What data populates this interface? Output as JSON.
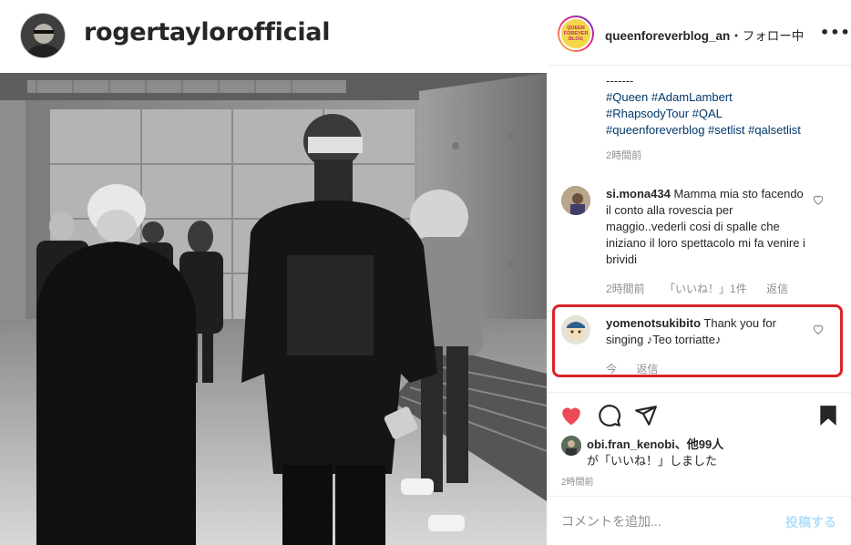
{
  "post": {
    "author": "rogertaylorofficial"
  },
  "panel": {
    "account": "queenforeverblog_an",
    "follow_status": "・フォロー中",
    "more": "•••",
    "avatar_text": "QUEEN FOREVER BLOG"
  },
  "caption": {
    "divider": "-------",
    "lines": [
      "#Queen #AdamLambert",
      "#RhapsodyTour #QAL",
      "#queenforeverblog #setlist #qalsetlist"
    ],
    "time": "2時間前"
  },
  "comments": [
    {
      "user": "si.mona434",
      "text": "Mamma mia sto facendo il conto alla rovescia per maggio..vederli cosi di spalle che iniziano il loro spettacolo mi fa venire i brividi",
      "time": "2時間前",
      "likes": "「いいね！」1件",
      "reply": "返信"
    },
    {
      "user": "yomenotsukibito",
      "text": "Thank you for singing ♪Teo torriatte♪",
      "time": "今",
      "reply": "返信"
    }
  ],
  "likes": {
    "line1": "obi.fran_kenobi、他99人",
    "line2": "が「いいね！」しました"
  },
  "post_time": "2時間前",
  "add_comment": {
    "placeholder": "コメントを追加...",
    "post_label": "投稿する"
  },
  "colors": {
    "like_red": "#ed4956",
    "highlight": "#d9232a",
    "hashtag": "#00376b",
    "post_disabled": "#b2dffc"
  }
}
